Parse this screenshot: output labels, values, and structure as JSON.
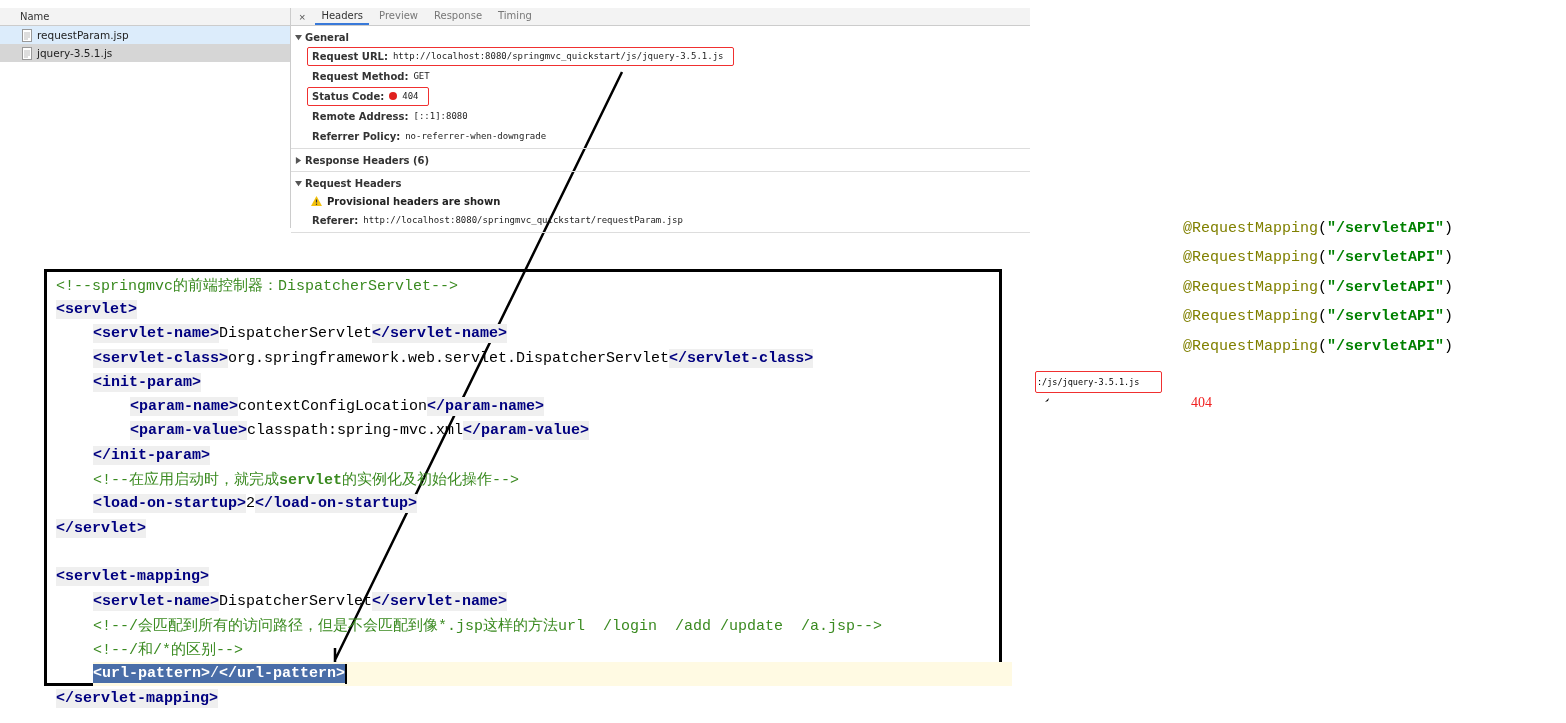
{
  "devtools": {
    "name_column": {
      "header": "Name",
      "files": [
        {
          "name": "requestParam.jsp",
          "selected": false,
          "hovered": true
        },
        {
          "name": "jquery-3.5.1.js",
          "selected": true,
          "hovered": false
        }
      ]
    },
    "close_label": "×",
    "tabs": [
      {
        "label": "Headers",
        "selected": true
      },
      {
        "label": "Preview",
        "selected": false
      },
      {
        "label": "Response",
        "selected": false
      },
      {
        "label": "Timing",
        "selected": false
      }
    ],
    "sections": [
      {
        "title": "General",
        "expanded": true,
        "rows": [
          {
            "kind": "field",
            "label": "Request URL:",
            "value": "http://localhost:8080/springmvc_quickstart/js/jquery-3.5.1.js",
            "highlighted": true
          },
          {
            "kind": "field",
            "label": "Request Method:",
            "value": "GET",
            "highlighted": false
          },
          {
            "kind": "status",
            "label": "Status Code:",
            "value": "404",
            "highlighted": true
          },
          {
            "kind": "field",
            "label": "Remote Address:",
            "value": "[::1]:8080",
            "highlighted": false
          },
          {
            "kind": "field",
            "label": "Referrer Policy:",
            "value": "no-referrer-when-downgrade",
            "highlighted": false
          }
        ]
      },
      {
        "title": "Response Headers (6)",
        "expanded": false
      },
      {
        "title": "Request Headers",
        "expanded": true,
        "warning": "Provisional headers are shown",
        "rows": [
          {
            "kind": "field",
            "label": "Referer:",
            "value": "http://localhost:8080/springmvc_quickstart/requestParam.jsp",
            "highlighted": false
          }
        ]
      }
    ]
  },
  "code_editor": {
    "blocks": [
      [
        {
          "selected": false,
          "tokens": [
            {
              "kind": "comment",
              "text": "<!--springmvc的前端控制器：DispatcherServlet-->"
            }
          ]
        },
        {
          "selected": false,
          "tokens": [
            {
              "kind": "tag",
              "text": "<servlet>"
            }
          ],
          "children": [
            {
              "selected": false,
              "tokens": [
                {
                  "kind": "tag",
                  "text": "<servlet-name>"
                },
                {
                  "kind": "text",
                  "text": "DispatcherServlet"
                },
                {
                  "kind": "tag",
                  "text": "</servlet-name>"
                }
              ]
            },
            {
              "selected": false,
              "tokens": [
                {
                  "kind": "tag",
                  "text": "<servlet-class>"
                },
                {
                  "kind": "text",
                  "text": "org.springframework.web.servlet.DispatcherServlet"
                },
                {
                  "kind": "tag",
                  "text": "</servlet-class>"
                }
              ]
            },
            {
              "selected": false,
              "tokens": [
                {
                  "kind": "tag",
                  "text": "<init-param>"
                }
              ],
              "children": [
                {
                  "selected": false,
                  "tokens": [
                    {
                      "kind": "tag",
                      "text": "<param-name>"
                    },
                    {
                      "kind": "text",
                      "text": "contextConfigLocation"
                    },
                    {
                      "kind": "tag",
                      "text": "</param-name>"
                    }
                  ]
                },
                {
                  "selected": false,
                  "tokens": [
                    {
                      "kind": "tag",
                      "text": "<param-value>"
                    },
                    {
                      "kind": "text",
                      "text": "classpath:spring-mvc.xml"
                    },
                    {
                      "kind": "tag",
                      "text": "</param-value>"
                    }
                  ]
                }
              ]
            },
            {
              "selected": false,
              "tokens": [
                {
                  "kind": "tag",
                  "text": "</init-param>"
                }
              ]
            },
            {
              "selected": false,
              "tokens": [
                {
                  "kind": "comment",
                  "text": "<!--在应用启动时，就完成**servlet**的实例化及初始化操作-->"
                }
              ]
            },
            {
              "selected": false,
              "tokens": [
                {
                  "kind": "tag",
                  "text": "<load-on-startup>"
                },
                {
                  "kind": "text",
                  "text": "2"
                },
                {
                  "kind": "tag",
                  "text": "</load-on-startup>"
                }
              ]
            }
          ]
        },
        {
          "selected": false,
          "tokens": [
            {
              "kind": "tag",
              "text": "</servlet>"
            }
          ]
        }
      ],
      [
        {
          "selected": false,
          "tokens": [
            {
              "kind": "tag",
              "text": "<servlet-mapping>"
            }
          ],
          "children": [
            {
              "selected": false,
              "tokens": [
                {
                  "kind": "tag",
                  "text": "<servlet-name>"
                },
                {
                  "kind": "text",
                  "text": "DispatcherServlet"
                },
                {
                  "kind": "tag",
                  "text": "</servlet-name>"
                }
              ]
            },
            {
              "selected": false,
              "tokens": [
                {
                  "kind": "comment",
                  "text": "<!--/会匹配到所有的访问路径，但是不会匹配到像*.jsp这样的方法url  /login  /add /update  /a.jsp-->"
                }
              ]
            },
            {
              "selected": false,
              "tokens": [
                {
                  "kind": "comment",
                  "text": "<!--/和/*的区别-->"
                }
              ]
            },
            {
              "selected": true,
              "tokens": [
                {
                  "kind": "tag",
                  "text": "<url-pattern>"
                },
                {
                  "kind": "text",
                  "text": "/"
                },
                {
                  "kind": "tag",
                  "text": "</url-pattern>"
                }
              ]
            }
          ]
        },
        {
          "selected": false,
          "tokens": [
            {
              "kind": "tag",
              "text": "</servlet-mapping>"
            }
          ]
        }
      ]
    ]
  },
  "annotations": {
    "mappings": [
      [
        {
          "kind": "annotation",
          "text": "@RequestMapping"
        },
        {
          "kind": "punct",
          "text": "("
        },
        {
          "kind": "string",
          "text": "\"/servletAPI\""
        },
        {
          "kind": "punct",
          "text": ")"
        }
      ],
      [
        {
          "kind": "annotation",
          "text": "@RequestMapping"
        },
        {
          "kind": "punct",
          "text": "("
        },
        {
          "kind": "string",
          "text": "\"/servletAPI\""
        },
        {
          "kind": "punct",
          "text": ")"
        }
      ],
      [
        {
          "kind": "annotation",
          "text": "@RequestMapping"
        },
        {
          "kind": "punct",
          "text": "("
        },
        {
          "kind": "string",
          "text": "\"/servletAPI\""
        },
        {
          "kind": "punct",
          "text": ")"
        }
      ],
      [
        {
          "kind": "annotation",
          "text": "@RequestMapping"
        },
        {
          "kind": "punct",
          "text": "("
        },
        {
          "kind": "string",
          "text": "\"/servletAPI\""
        },
        {
          "kind": "punct",
          "text": ")"
        }
      ],
      [
        {
          "kind": "annotation",
          "text": "@RequestMapping"
        },
        {
          "kind": "punct",
          "text": "("
        },
        {
          "kind": "string",
          "text": "\"/servletAPI\""
        },
        {
          "kind": "punct",
          "text": ")"
        }
      ]
    ],
    "url_fragment": ":/js/jquery-3.5.1.js",
    "status_text": "404"
  }
}
